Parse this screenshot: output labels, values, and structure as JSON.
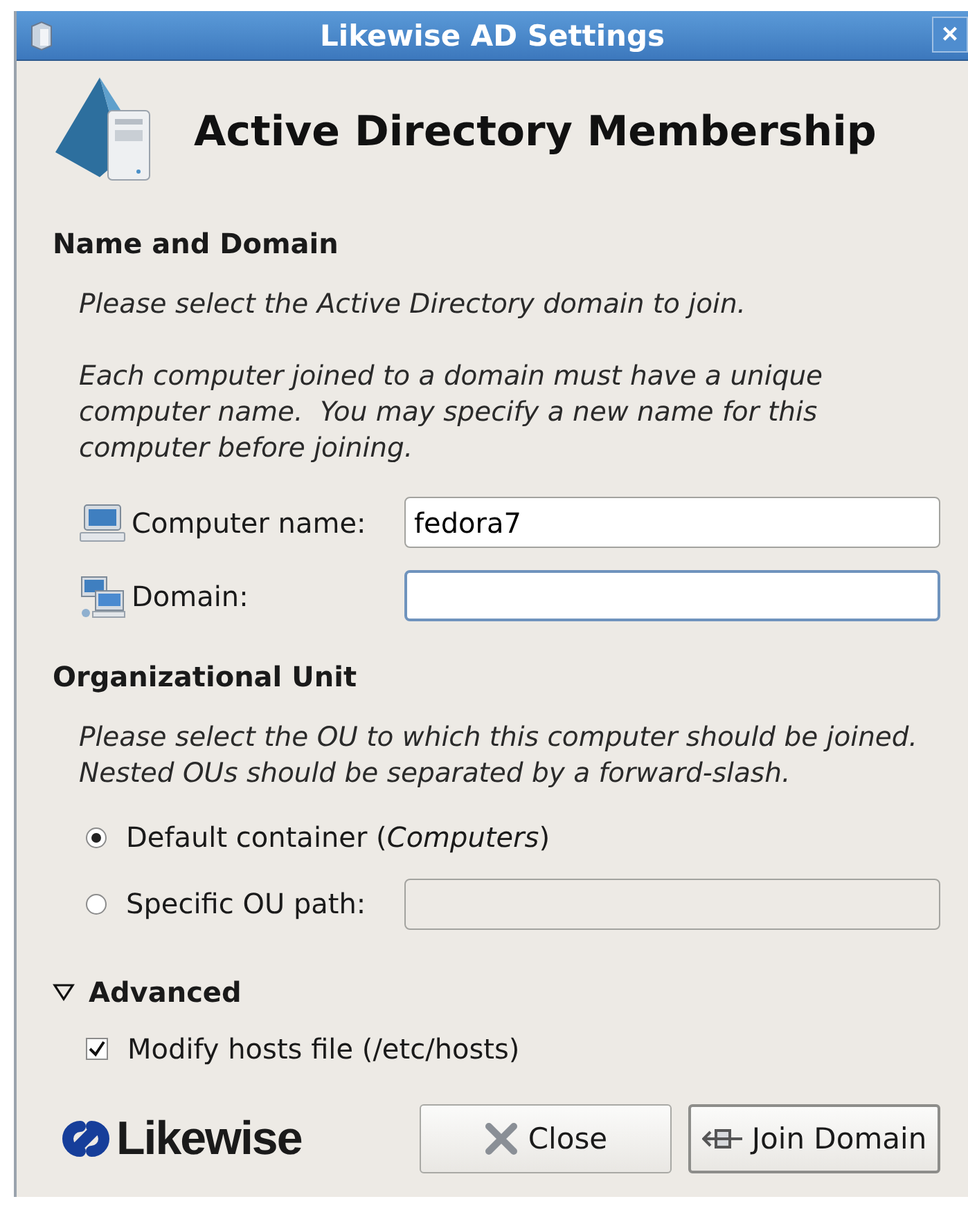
{
  "window": {
    "title": "Likewise AD Settings",
    "close": "×"
  },
  "header": {
    "title": "Active Directory Membership"
  },
  "name_and_domain": {
    "heading": "Name and Domain",
    "paragraphs": [
      "Please select the Active Directory domain to join.",
      "Each computer joined to a domain must have a unique computer name.  You may specify a new name for this computer before joining."
    ],
    "fields": [
      {
        "kind": "computer",
        "label": "Computer name:",
        "value": "fedora7",
        "focused": false
      },
      {
        "kind": "domain",
        "label": "Domain:",
        "focused": true
      }
    ]
  },
  "organizational_unit": {
    "heading": "Organizational Unit",
    "paragraph": "Please select the OU to which this computer should be joined. Nested OUs should be separated by a forward-slash.",
    "options": [
      {
        "label": "Default container (*Computers*)",
        "selected": true,
        "has_field": false
      },
      {
        "label": "Specific OU path:",
        "selected": false,
        "has_field": true,
        "field_disabled": true
      }
    ]
  },
  "advanced": {
    "label": "Advanced",
    "expanded": true,
    "options": [
      {
        "label": "Modify hosts file (/etc/hosts)",
        "checked": true
      }
    ]
  },
  "footer": {
    "logo": "Likewise",
    "buttons": [
      {
        "kind": "close",
        "label": "Close"
      },
      {
        "kind": "join",
        "label": "Join Domain"
      }
    ]
  }
}
